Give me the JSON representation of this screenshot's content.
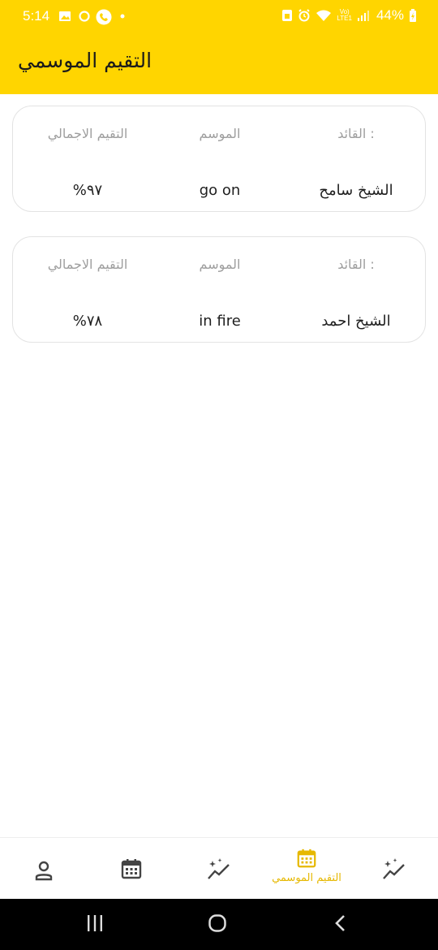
{
  "status_bar": {
    "time": "5:14",
    "network_small": "Vo)\nLTE1",
    "battery": "44%"
  },
  "header": {
    "title": "التقيم الموسمي"
  },
  "cards": [
    {
      "leader_label": "القائد :",
      "leader_value": "الشيخ سامح",
      "season_label": "الموسم",
      "season_value": "go on",
      "total_label": "التقيم الاجمالي",
      "total_value": "%٩٧"
    },
    {
      "leader_label": "القائد :",
      "leader_value": "الشيخ احمد",
      "season_label": "الموسم",
      "season_value": "in fire",
      "total_label": "التقيم الاجمالي",
      "total_value": "%٧٨"
    }
  ],
  "bottom_nav": {
    "items": [
      {
        "icon": "sparkles-chart-icon",
        "label": ""
      },
      {
        "icon": "calendar-icon",
        "label": "التقيم الموسمي",
        "active": true
      },
      {
        "icon": "sparkles-chart-icon",
        "label": ""
      },
      {
        "icon": "calendar-icon",
        "label": ""
      },
      {
        "icon": "profile-icon",
        "label": ""
      }
    ]
  },
  "colors": {
    "accent": "#FFD500",
    "active_nav": "#E6B800",
    "label_gray": "#9e9e9e"
  }
}
